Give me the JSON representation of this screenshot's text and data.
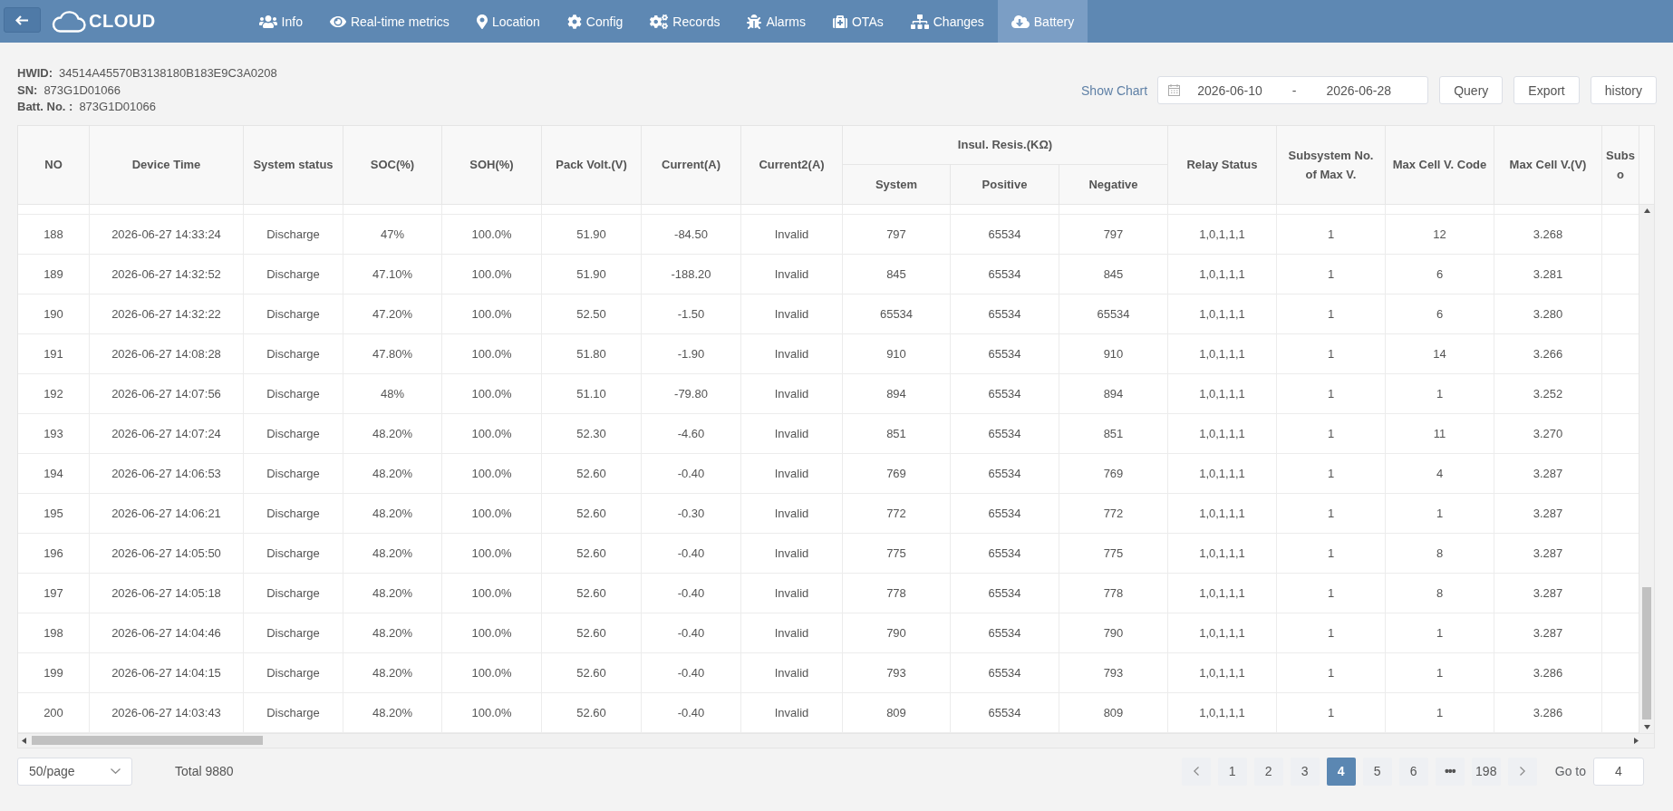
{
  "header": {
    "logo": "CLOUD",
    "tabs": [
      {
        "label": "Info",
        "selected": false
      },
      {
        "label": "Real-time metrics",
        "selected": false
      },
      {
        "label": "Location",
        "selected": false
      },
      {
        "label": "Config",
        "selected": false
      },
      {
        "label": "Records",
        "selected": false
      },
      {
        "label": "Alarms",
        "selected": false
      },
      {
        "label": "OTAs",
        "selected": false
      },
      {
        "label": "Changes",
        "selected": false
      },
      {
        "label": "Battery",
        "selected": true
      }
    ]
  },
  "device_info": [
    {
      "label": "HWID:",
      "value": "34514A45570B3138180B183E9C3A0208"
    },
    {
      "label": "SN:",
      "value": "873G1D01066"
    },
    {
      "label": "Batt. No. :",
      "value": "873G1D01066"
    }
  ],
  "toolbar": {
    "show_chart": "Show Chart",
    "date_range": {
      "start": "2026-06-10",
      "separator": "-",
      "end": "2026-06-28"
    },
    "buttons": [
      "Query",
      "Export",
      "history"
    ]
  },
  "table": {
    "column_group": "Insul. Resis.(KΩ)",
    "columns": [
      {
        "label": "NO",
        "grouped": false
      },
      {
        "label": "Device Time",
        "grouped": false
      },
      {
        "label": "System status",
        "grouped": false
      },
      {
        "label": "SOC(%)",
        "grouped": false
      },
      {
        "label": "SOH(%)",
        "grouped": false
      },
      {
        "label": "Pack Volt.(V)",
        "grouped": false
      },
      {
        "label": "Current(A)",
        "grouped": false
      },
      {
        "label": "Current2(A)",
        "grouped": false
      },
      {
        "label": "System",
        "grouped": true
      },
      {
        "label": "Positive",
        "grouped": true
      },
      {
        "label": "Negative",
        "grouped": true
      },
      {
        "label": "Relay Status",
        "grouped": false
      },
      {
        "label": "Subsystem No. of Max V.",
        "grouped": false
      },
      {
        "label": "Max Cell V. Code",
        "grouped": false
      },
      {
        "label": "Max Cell V.(V)",
        "grouped": false
      },
      {
        "label": "Subs o",
        "grouped": false
      }
    ],
    "rows": [
      [
        "188",
        "2026-06-27 14:33:24",
        "Discharge",
        "47%",
        "100.0%",
        "51.90",
        "-84.50",
        "Invalid",
        "797",
        "65534",
        "797",
        "1,0,1,1,1",
        "1",
        "12",
        "3.268"
      ],
      [
        "189",
        "2026-06-27 14:32:52",
        "Discharge",
        "47.10%",
        "100.0%",
        "51.90",
        "-188.20",
        "Invalid",
        "845",
        "65534",
        "845",
        "1,0,1,1,1",
        "1",
        "6",
        "3.281"
      ],
      [
        "190",
        "2026-06-27 14:32:22",
        "Discharge",
        "47.20%",
        "100.0%",
        "52.50",
        "-1.50",
        "Invalid",
        "65534",
        "65534",
        "65534",
        "1,0,1,1,1",
        "1",
        "6",
        "3.280"
      ],
      [
        "191",
        "2026-06-27 14:08:28",
        "Discharge",
        "47.80%",
        "100.0%",
        "51.80",
        "-1.90",
        "Invalid",
        "910",
        "65534",
        "910",
        "1,0,1,1,1",
        "1",
        "14",
        "3.266"
      ],
      [
        "192",
        "2026-06-27 14:07:56",
        "Discharge",
        "48%",
        "100.0%",
        "51.10",
        "-79.80",
        "Invalid",
        "894",
        "65534",
        "894",
        "1,0,1,1,1",
        "1",
        "1",
        "3.252"
      ],
      [
        "193",
        "2026-06-27 14:07:24",
        "Discharge",
        "48.20%",
        "100.0%",
        "52.30",
        "-4.60",
        "Invalid",
        "851",
        "65534",
        "851",
        "1,0,1,1,1",
        "1",
        "11",
        "3.270"
      ],
      [
        "194",
        "2026-06-27 14:06:53",
        "Discharge",
        "48.20%",
        "100.0%",
        "52.60",
        "-0.40",
        "Invalid",
        "769",
        "65534",
        "769",
        "1,0,1,1,1",
        "1",
        "4",
        "3.287"
      ],
      [
        "195",
        "2026-06-27 14:06:21",
        "Discharge",
        "48.20%",
        "100.0%",
        "52.60",
        "-0.30",
        "Invalid",
        "772",
        "65534",
        "772",
        "1,0,1,1,1",
        "1",
        "1",
        "3.287"
      ],
      [
        "196",
        "2026-06-27 14:05:50",
        "Discharge",
        "48.20%",
        "100.0%",
        "52.60",
        "-0.40",
        "Invalid",
        "775",
        "65534",
        "775",
        "1,0,1,1,1",
        "1",
        "8",
        "3.287"
      ],
      [
        "197",
        "2026-06-27 14:05:18",
        "Discharge",
        "48.20%",
        "100.0%",
        "52.60",
        "-0.40",
        "Invalid",
        "778",
        "65534",
        "778",
        "1,0,1,1,1",
        "1",
        "8",
        "3.287"
      ],
      [
        "198",
        "2026-06-27 14:04:46",
        "Discharge",
        "48.20%",
        "100.0%",
        "52.60",
        "-0.40",
        "Invalid",
        "790",
        "65534",
        "790",
        "1,0,1,1,1",
        "1",
        "1",
        "3.287"
      ],
      [
        "199",
        "2026-06-27 14:04:15",
        "Discharge",
        "48.20%",
        "100.0%",
        "52.60",
        "-0.40",
        "Invalid",
        "793",
        "65534",
        "793",
        "1,0,1,1,1",
        "1",
        "1",
        "3.286"
      ],
      [
        "200",
        "2026-06-27 14:03:43",
        "Discharge",
        "48.20%",
        "100.0%",
        "52.60",
        "-0.40",
        "Invalid",
        "809",
        "65534",
        "809",
        "1,0,1,1,1",
        "1",
        "1",
        "3.286"
      ]
    ]
  },
  "pagination": {
    "page_size": "50/page",
    "total": "Total 9880",
    "pages": [
      {
        "label": "1",
        "kind": "page",
        "selected": false
      },
      {
        "label": "2",
        "kind": "page",
        "selected": false
      },
      {
        "label": "3",
        "kind": "page",
        "selected": false
      },
      {
        "label": "4",
        "kind": "page",
        "selected": true
      },
      {
        "label": "5",
        "kind": "page",
        "selected": false
      },
      {
        "label": "6",
        "kind": "page",
        "selected": false
      },
      {
        "label": "•••",
        "kind": "ellipsis",
        "selected": false
      },
      {
        "label": "198",
        "kind": "page",
        "selected": false
      }
    ],
    "goto_label": "Go to",
    "goto_value": "4"
  }
}
